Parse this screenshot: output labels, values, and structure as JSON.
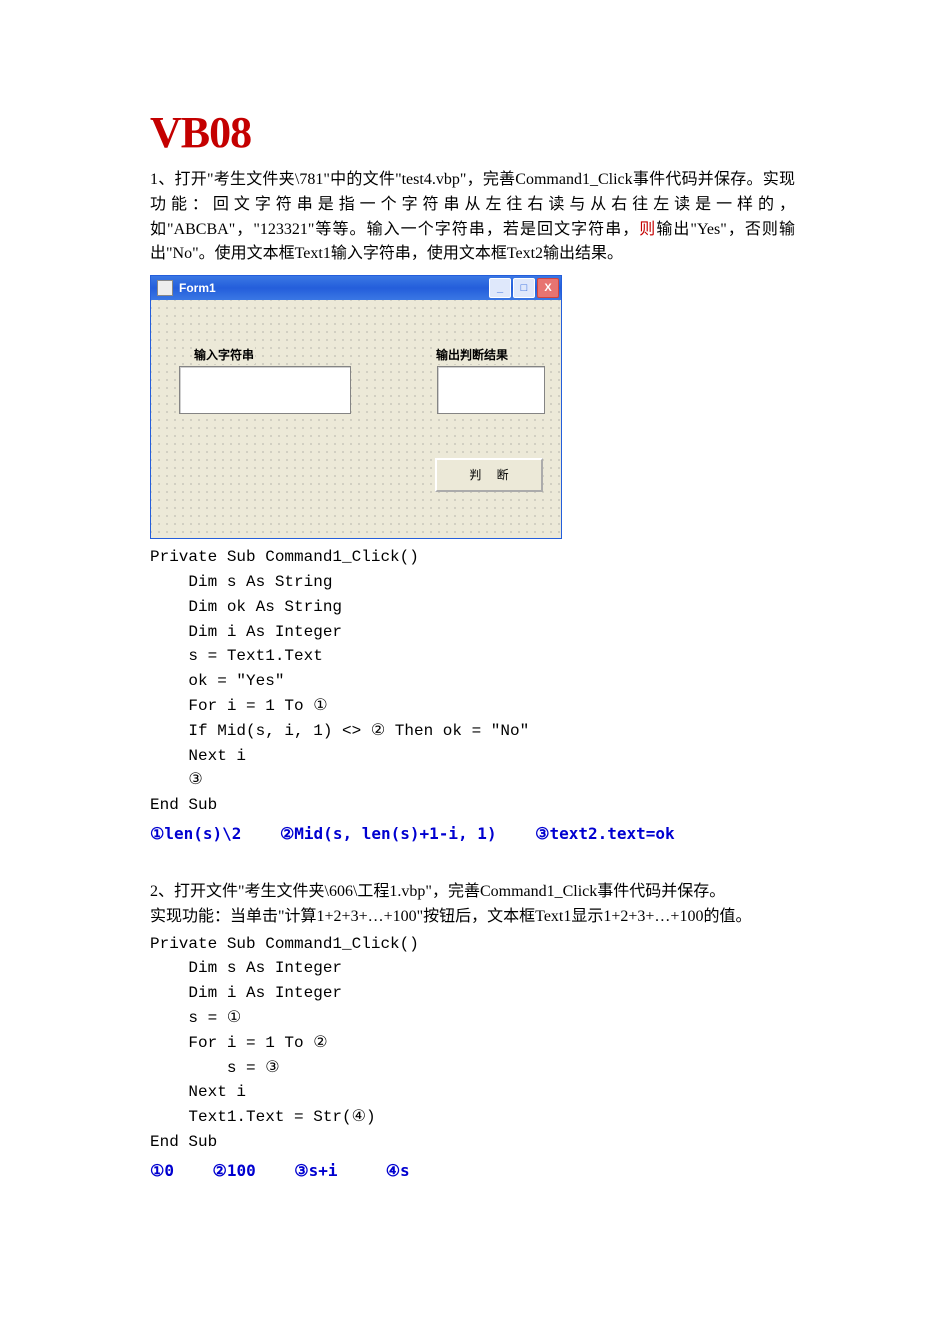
{
  "title": "VB08",
  "q1": {
    "text": "1、打开\"考生文件夹\\781\"中的文件\"test4.vbp\"，完善Command1_Click事件代码并保存。实现功能：回文字符串是指一个字符串从左往右读与从右往左读是一样的，如\"ABCBA\"，\"123321\"等等。输入一个字符串，若是回文字符串，",
    "text_red": "则",
    "text_tail": "输出\"Yes\"，否则输出\"No\"。使用文本框Text1输入字符串，使用文本框Text2输出结果。"
  },
  "form": {
    "title": "Form1",
    "label1": "输入字符串",
    "label2": "输出判断结果",
    "button": "判 断",
    "min": "_",
    "max": "□",
    "close": "X"
  },
  "code1": "Private Sub Command1_Click()\n    Dim s As String\n    Dim ok As String\n    Dim i As Integer\n    s = Text1.Text\n    ok = \"Yes\"\n    For i = 1 To ①\n    If Mid(s, i, 1) <> ② Then ok = \"No\"\n    Next i\n    ③\nEnd Sub",
  "ans1": "①len(s)\\2    ②Mid(s, len(s)+1-i, 1)    ③text2.text=ok",
  "q2": {
    "line1": "2、打开文件\"考生文件夹\\606\\工程1.vbp\"，完善Command1_Click事件代码并保存。",
    "line2": "实现功能：当单击\"计算1+2+3+…+100\"按钮后，文本框Text1显示1+2+3+…+100的值。"
  },
  "code2": "Private Sub Command1_Click()\n    Dim s As Integer\n    Dim i As Integer\n    s = ①\n    For i = 1 To ②\n        s = ③\n    Next i\n    Text1.Text = Str(④)\nEnd Sub",
  "ans2": "①0    ②100    ③s+i     ④s"
}
